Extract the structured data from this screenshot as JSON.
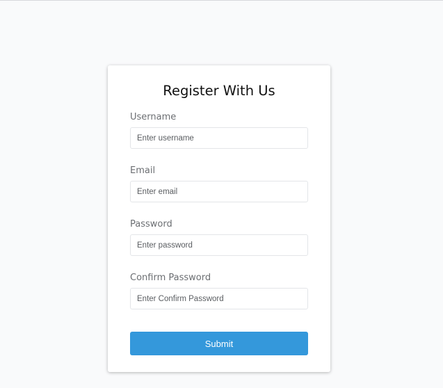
{
  "form": {
    "title": "Register With Us",
    "fields": [
      {
        "label": "Username",
        "placeholder": "Enter username",
        "value": ""
      },
      {
        "label": "Email",
        "placeholder": "Enter email",
        "value": ""
      },
      {
        "label": "Password",
        "placeholder": "Enter password",
        "value": ""
      },
      {
        "label": "Confirm Password",
        "placeholder": "Enter Confirm Password",
        "value": ""
      }
    ],
    "submit_label": "Submit"
  },
  "colors": {
    "background": "#f9fafb",
    "card": "#ffffff",
    "accent": "#3498db",
    "label_text": "#6b6e72"
  }
}
